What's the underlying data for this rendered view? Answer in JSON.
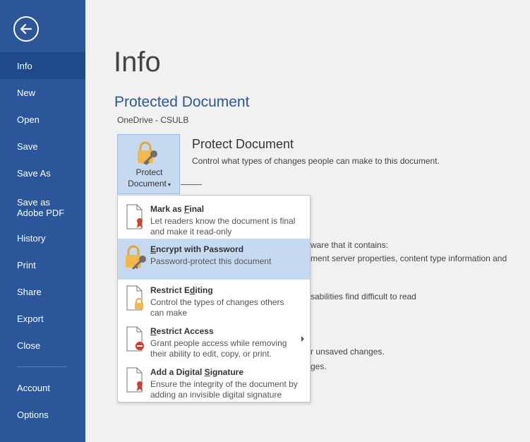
{
  "sidebar": {
    "items": [
      {
        "label": "Info",
        "active": true
      },
      {
        "label": "New"
      },
      {
        "label": "Open"
      },
      {
        "label": "Save"
      },
      {
        "label": "Save As"
      },
      {
        "label": "Save as Adobe PDF"
      },
      {
        "label": "History"
      },
      {
        "label": "Print"
      },
      {
        "label": "Share"
      },
      {
        "label": "Export"
      },
      {
        "label": "Close"
      },
      {
        "label": "Account"
      },
      {
        "label": "Options"
      }
    ],
    "color": "#2b579a",
    "active_color": "#1e4a8c"
  },
  "main": {
    "heading": "Info",
    "doc_title": "Protected Document",
    "doc_location": "OneDrive - CSULB",
    "protect_button": {
      "line1": "Protect",
      "line2": "Document"
    },
    "protect_heading": "Protect Document",
    "protect_desc": "Control what types of changes people can make to this document.",
    "partial_texts": [
      "ware that it contains:",
      "ment server properties, content type information and",
      "sabilities find difficult to read",
      "r unsaved changes.",
      "ges."
    ]
  },
  "menu": {
    "items": [
      {
        "title_pre": "Mark as ",
        "title_key": "F",
        "title_post": "inal",
        "desc": "Let readers know the document is final and make it read-only",
        "icon": "mark-final-icon"
      },
      {
        "title_pre": "",
        "title_key": "E",
        "title_post": "ncrypt with Password",
        "desc": "Password-protect this document",
        "icon": "lock-key-icon",
        "highlighted": true
      },
      {
        "title_pre": "Restrict E",
        "title_key": "d",
        "title_post": "iting",
        "desc": "Control the types of changes others can make",
        "icon": "restrict-editing-icon"
      },
      {
        "title_pre": "",
        "title_key": "R",
        "title_post": "estrict Access",
        "desc": "Grant people access while removing their ability to edit, copy, or print.",
        "icon": "restrict-access-icon",
        "has_submenu": true
      },
      {
        "title_pre": "Add a Digital ",
        "title_key": "S",
        "title_post": "ignature",
        "desc": "Ensure the integrity of the document by adding an invisible digital signature",
        "icon": "digital-signature-icon"
      }
    ]
  }
}
